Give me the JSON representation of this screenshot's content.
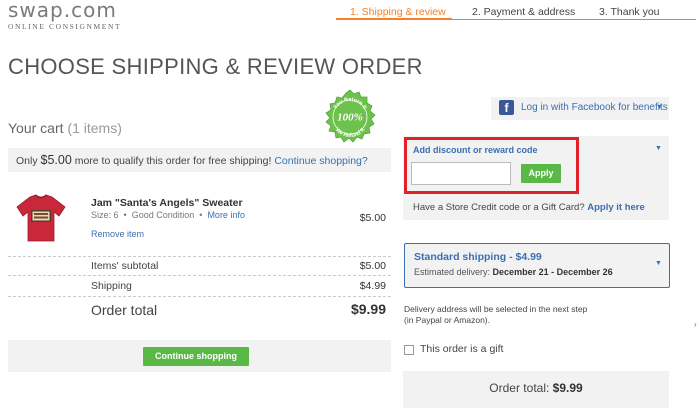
{
  "header": {
    "logo_main": "swap.com",
    "logo_sub": "ONLINE CONSIGNMENT",
    "steps": [
      "1. Shipping & review",
      "2. Payment & address",
      "3. Thank you"
    ],
    "active_step_color": "#f5802a"
  },
  "page_title": "CHOOSE SHIPPING & REVIEW ORDER",
  "cart": {
    "title": "Your cart",
    "count": "(1 items)",
    "badge_top": "You Return It",
    "badge_mid": "100%",
    "badge_bottom": "We Refund It",
    "banner_pre": "Only",
    "banner_amount": "$5.00",
    "banner_post": "more to qualify this order for free shipping!",
    "banner_link": "Continue shopping?",
    "item": {
      "name": "Jam \"Santa's Angels\" Sweater",
      "size": "Size: 6",
      "sep": "•",
      "condition": "Good Condition",
      "more_info": "More info",
      "price": "$5.00",
      "remove": "Remove item"
    },
    "subtotal_label": "Items' subtotal",
    "subtotal_value": "$5.00",
    "shipping_label": "Shipping",
    "shipping_value": "$4.99",
    "total_label": "Order total",
    "total_value": "$9.99",
    "continue_button": "Continue shopping"
  },
  "sidebar": {
    "facebook_label": "Log in with Facebook for benefits",
    "facebook_icon": "f",
    "discount_title": "Add discount or reward code",
    "discount_placeholder": "",
    "apply_button": "Apply",
    "credit_text": "Have a Store Credit code or a Gift Card?",
    "credit_link": "Apply it here",
    "shipping_option": "Standard shipping - $4.99",
    "delivery_label": "Estimated delivery:",
    "delivery_dates": "December 21 - December 26",
    "address_note_1": "Delivery address will be selected in the next step",
    "address_note_2": "(in Paypal or Amazon).",
    "gift_label": "This order is a gift",
    "order_total_label": "Order total:",
    "order_total_value": "$9.99"
  },
  "colors": {
    "accent_blue": "#3a6fb0",
    "button_green": "#5ab946",
    "highlight_red": "#e0232b"
  }
}
